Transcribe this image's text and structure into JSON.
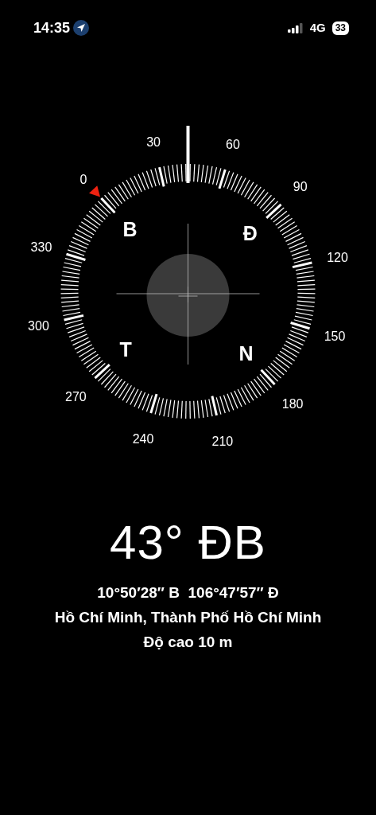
{
  "status_bar": {
    "time": "14:35",
    "network": "4G",
    "battery": "33",
    "location_active": true
  },
  "dial": {
    "degree_labels": [
      "0",
      "30",
      "60",
      "90",
      "120",
      "150",
      "180",
      "210",
      "240",
      "270",
      "300",
      "330"
    ],
    "cardinals": [
      "B",
      "Đ",
      "T",
      "N"
    ]
  },
  "heading": "43° ĐB",
  "coordinates": "10°50′28″ B  106°47′57″ Đ",
  "location": "Hồ Chí Minh, Thành Phố Hồ Chí Minh",
  "altitude": "Độ cao 10 m"
}
